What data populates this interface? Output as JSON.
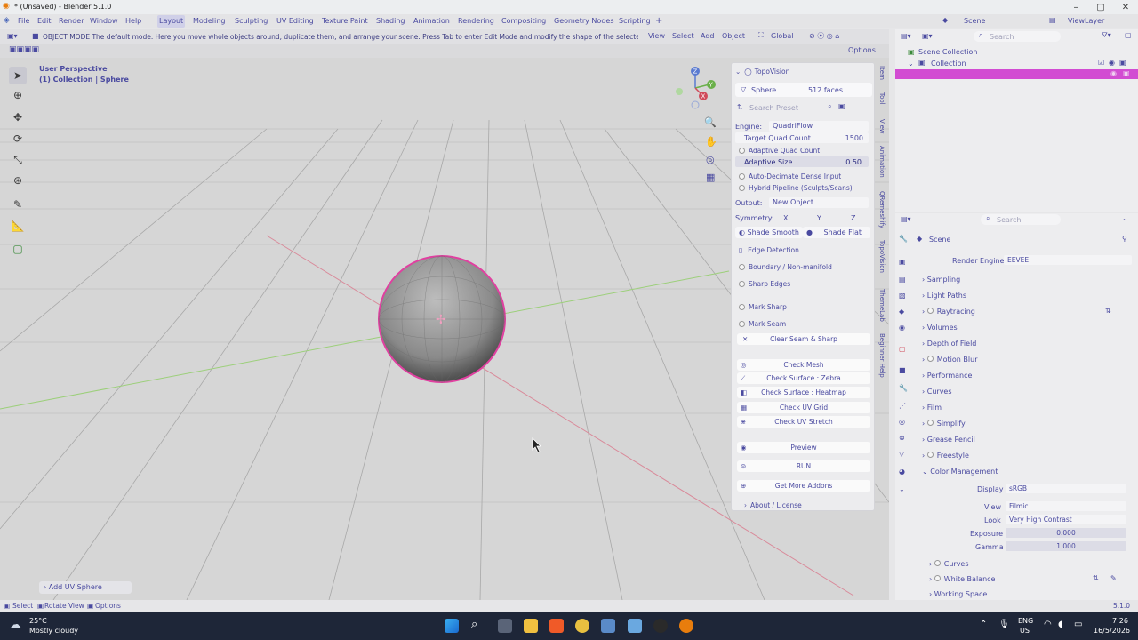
{
  "window": {
    "title": "* (Unsaved) - Blender 5.1.0"
  },
  "menu": {
    "items": [
      "File",
      "Edit",
      "Render",
      "Window",
      "Help"
    ]
  },
  "workspaces": [
    "Layout",
    "Modeling",
    "Sculpting",
    "UV Editing",
    "Texture Paint",
    "Shading",
    "Animation",
    "Rendering",
    "Compositing",
    "Geometry Nodes",
    "Scripting"
  ],
  "scene": {
    "scene_name": "Scene",
    "view_layer": "ViewLayer"
  },
  "header": {
    "mode_tip": "OBJECT MODE The default mode. Here you move whole objects around, duplicate them, and arrange your scene. Press Tab to enter Edit Mode and modify the shape of the selected object.",
    "view": "View",
    "select": "Select",
    "add": "Add",
    "object": "Object",
    "transform": "Global",
    "options": "Options"
  },
  "viewport": {
    "perspective": "User Perspective",
    "collection": "(1) Collection | Sphere",
    "last_op": "Add UV Sphere"
  },
  "topovision": {
    "title": "TopoVision",
    "object": "Sphere",
    "faces": "512 faces",
    "search_placeholder": "Search Preset",
    "engine_label": "Engine:",
    "engine": "QuadriFlow",
    "target_label": "Target Quad Count",
    "target": "1500",
    "adaptive_quad": "Adaptive Quad Count",
    "adaptive_size_label": "Adaptive Size",
    "adaptive_size": "0.50",
    "auto_decimate": "Auto-Decimate Dense Input",
    "hybrid": "Hybrid Pipeline (Sculpts/Scans)",
    "output_label": "Output:",
    "output": "New Object",
    "symmetry_label": "Symmetry:",
    "sym_x": "X",
    "sym_y": "Y",
    "sym_z": "Z",
    "shade_smooth": "Shade Smooth",
    "shade_flat": "Shade Flat",
    "edge_detection": "Edge Detection",
    "boundary": "Boundary / Non-manifold",
    "sharp_edges": "Sharp Edges",
    "mark_sharp": "Mark Sharp",
    "mark_seam": "Mark Seam",
    "clear_seam": "Clear Seam & Sharp",
    "check_mesh": "Check Mesh",
    "check_zebra": "Check Surface : Zebra",
    "check_heatmap": "Check Surface : Heatmap",
    "check_uv_grid": "Check UV Grid",
    "check_uv_stretch": "Check UV Stretch",
    "preview": "Preview",
    "run": "RUN",
    "more": "Get More Addons",
    "about": "About / License"
  },
  "vtabs": [
    "Item",
    "Tool",
    "View",
    "Animation",
    "QRemeshify",
    "TopoVision",
    "ThemeLab",
    "Beginner Help"
  ],
  "outliner": {
    "root": "Scene Collection",
    "collection": "Collection",
    "search_placeholder": "Search"
  },
  "props": {
    "search_placeholder": "Search",
    "scene": "Scene",
    "render_engine_label": "Render Engine",
    "render_engine": "EEVEE",
    "sections": [
      "Sampling",
      "Light Paths",
      "Raytracing",
      "Volumes",
      "Depth of Field",
      "Motion Blur",
      "Performance",
      "Curves",
      "Film",
      "Simplify",
      "Grease Pencil",
      "Freestyle",
      "Color Management"
    ],
    "display_label": "Display",
    "display": "sRGB",
    "view_label": "View",
    "view": "Filmic",
    "look_label": "Look",
    "look": "Very High Contrast",
    "exposure_label": "Exposure",
    "exposure": "0.000",
    "gamma_label": "Gamma",
    "gamma": "1.000",
    "sub_curves": "Curves",
    "white_balance": "White Balance",
    "working_space": "Working Space"
  },
  "status": {
    "select": "Select",
    "rotate": "Rotate View",
    "options": "Options",
    "version": "5.1.0"
  },
  "taskbar": {
    "temp": "25°C",
    "weather": "Mostly cloudy",
    "lang1": "ENG",
    "lang2": "US",
    "time": "7:26",
    "date": "16/5/2026"
  }
}
